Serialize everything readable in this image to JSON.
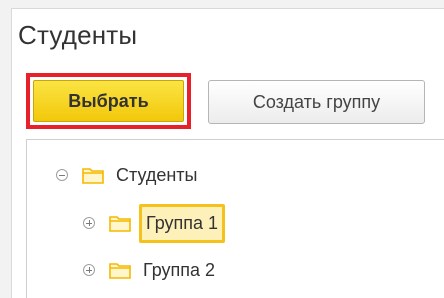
{
  "form": {
    "title": "Студенты"
  },
  "toolbar": {
    "select_label": "Выбрать",
    "create_group_label": "Создать группу"
  },
  "tree": {
    "root": {
      "label": "Студенты",
      "expanded": true,
      "icon": "folder-icon"
    },
    "children": [
      {
        "label": "Группа 1",
        "expanded": false,
        "selected": true,
        "icon": "folder-icon"
      },
      {
        "label": "Группа 2",
        "expanded": false,
        "selected": false,
        "icon": "folder-icon"
      }
    ]
  },
  "colors": {
    "select_button": "#f2c80b",
    "highlight_border": "#e8202a",
    "selection": "#fdf0b8",
    "folder": "#f5b800"
  }
}
